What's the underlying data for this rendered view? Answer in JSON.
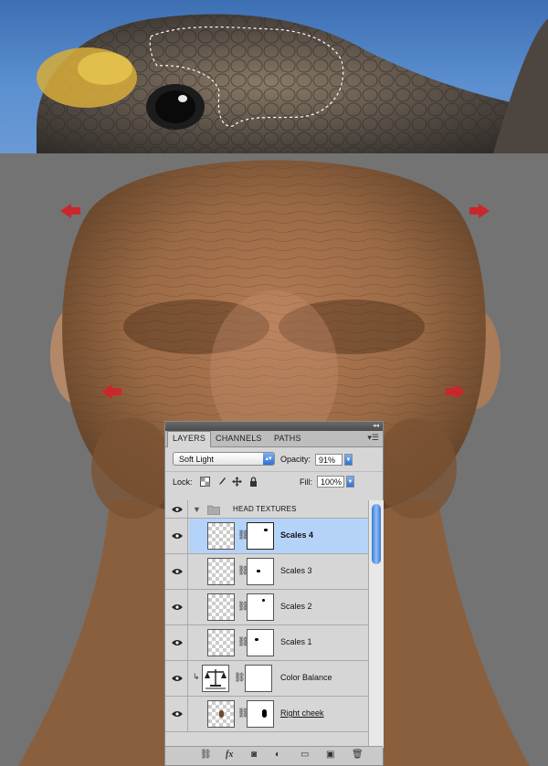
{
  "panel": {
    "tabs": [
      "LAYERS",
      "CHANNELS",
      "PATHS"
    ],
    "active_tab": "LAYERS",
    "blend_mode": "Soft Light",
    "opacity_label": "Opacity:",
    "opacity_value": "91%",
    "lock_label": "Lock:",
    "fill_label": "Fill:",
    "fill_value": "100%"
  },
  "layers": {
    "group": {
      "name": "HEAD TEXTURES"
    },
    "items": [
      {
        "name": "Scales 4",
        "selected": true
      },
      {
        "name": "Scales 3",
        "selected": false
      },
      {
        "name": "Scales 2",
        "selected": false
      },
      {
        "name": "Scales 1",
        "selected": false
      },
      {
        "name": "Color Balance",
        "selected": false
      },
      {
        "name": "Right cheek",
        "selected": false
      }
    ]
  },
  "icons": {
    "bottom_bar": [
      "link-icon",
      "fx-icon",
      "mask-icon",
      "adjustment-icon",
      "folder-icon",
      "new-layer-icon",
      "trash-icon"
    ]
  },
  "colors": {
    "selection_blue": "#b5d3f8",
    "arrow_red": "#c8282b"
  }
}
